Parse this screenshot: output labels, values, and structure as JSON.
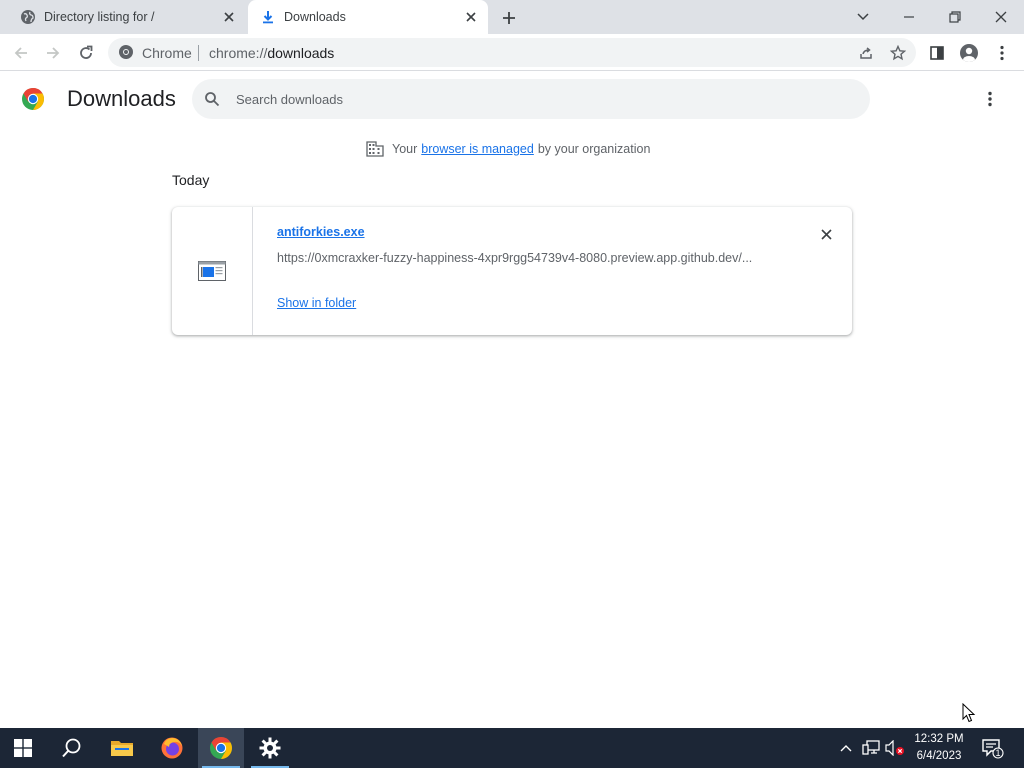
{
  "tabs": [
    {
      "title": "Directory listing for /",
      "icon": "globe-icon",
      "active": false
    },
    {
      "title": "Downloads",
      "icon": "download-icon",
      "active": true
    }
  ],
  "omnibox": {
    "site_label": "Chrome",
    "url_scheme": "chrome://",
    "url_path": "downloads"
  },
  "page": {
    "title": "Downloads",
    "search_placeholder": "Search downloads",
    "managed_prefix": "Your",
    "managed_link": "browser is managed",
    "managed_suffix": "by your organization",
    "section": "Today"
  },
  "download": {
    "filename": "antiforkies.exe",
    "url": "https://0xmcraxker-fuzzy-happiness-4xpr9rgg54739v4-8080.preview.app.github.dev/...",
    "action": "Show in folder"
  },
  "taskbar": {
    "time": "12:32 PM",
    "date": "6/4/2023",
    "notification_count": "1"
  },
  "colors": {
    "accent": "#1a73e8",
    "tabstrip": "#dee1e6",
    "taskbar": "#1c2636"
  }
}
